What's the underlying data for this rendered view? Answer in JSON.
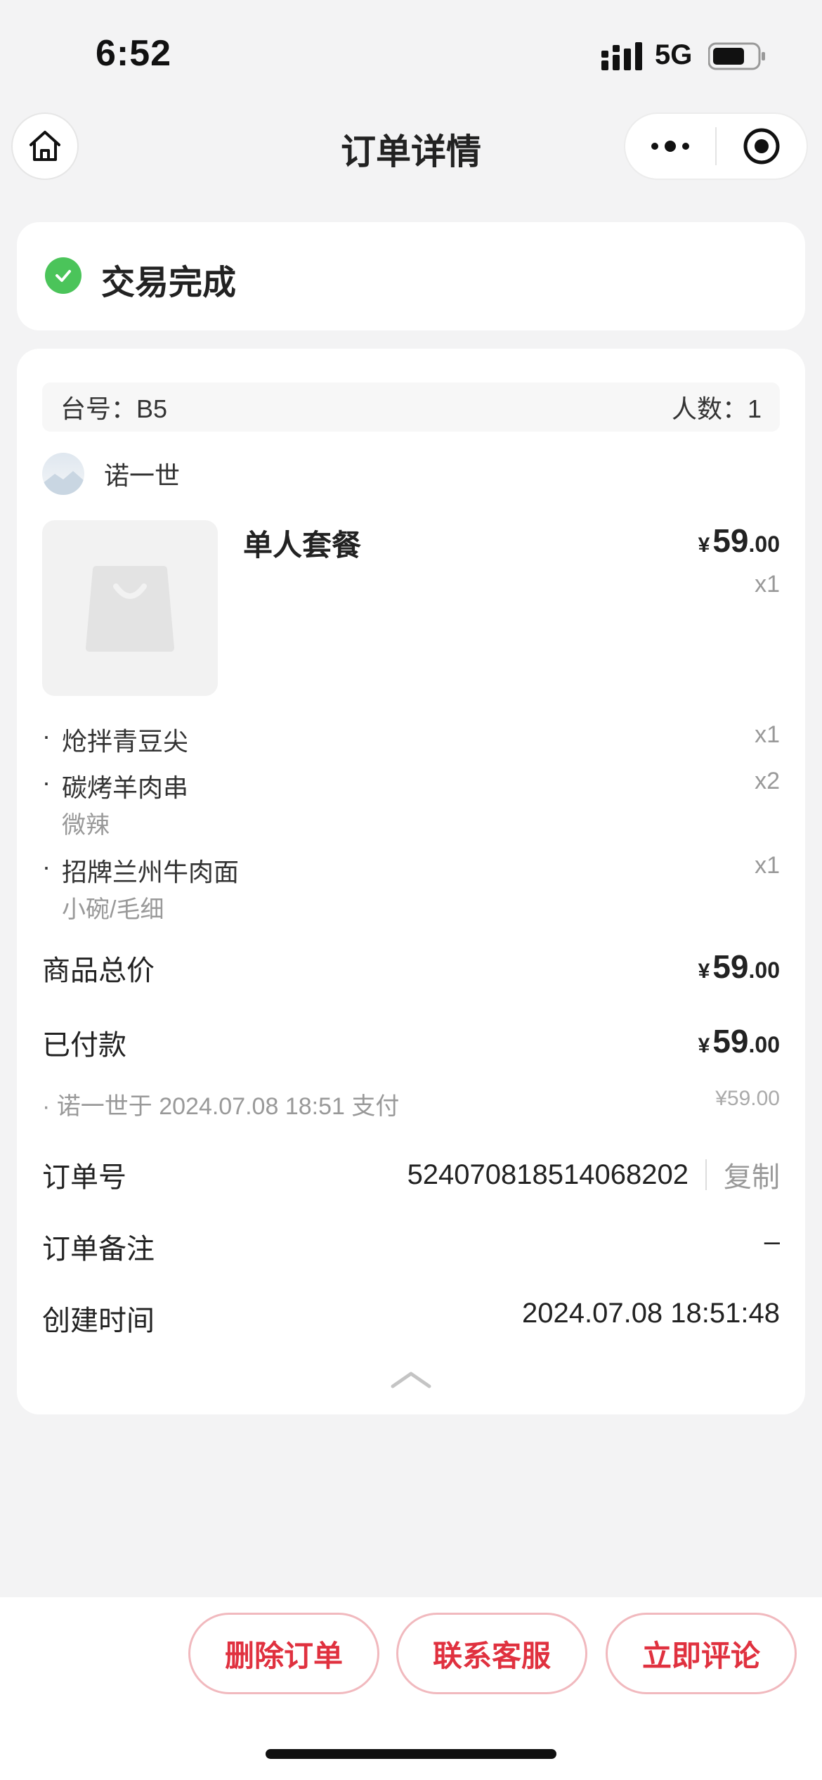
{
  "status_bar": {
    "time": "6:52",
    "network": "5G"
  },
  "nav": {
    "title": "订单详情"
  },
  "order_status": {
    "text": "交易完成",
    "color": "#4bc45a"
  },
  "table": {
    "table_label": "台号：B5",
    "people_label": "人数：1"
  },
  "shop": {
    "name": "诺一世"
  },
  "product": {
    "name": "单人套餐",
    "price_currency": "¥",
    "price_int": "59",
    "price_dec": ".00",
    "qty": "x1",
    "items": [
      {
        "name": "炝拌青豆尖",
        "qty": "x1",
        "note": ""
      },
      {
        "name": "碳烤羊肉串",
        "qty": "x2",
        "note": "微辣"
      },
      {
        "name": "招牌兰州牛肉面",
        "qty": "x1",
        "note": "小碗/毛细"
      }
    ]
  },
  "summary": {
    "total_label": "商品总价",
    "total_currency": "¥",
    "total_int": "59",
    "total_dec": ".00",
    "paid_label": "已付款",
    "paid_currency": "¥",
    "paid_int": "59",
    "paid_dec": ".00",
    "pay_note": "· 诺一世于 2024.07.08 18:51 支付",
    "pay_note_amount": "¥59.00",
    "order_no_label": "订单号",
    "order_no": "524070818514068202",
    "copy_label": "复制",
    "remark_label": "订单备注",
    "remark_value": "–",
    "created_label": "创建时间",
    "created_value": "2024.07.08 18:51:48"
  },
  "actions": {
    "delete_label": "删除订单",
    "contact_label": "联系客服",
    "review_label": "立即评论",
    "accent_color": "#e0313f"
  }
}
